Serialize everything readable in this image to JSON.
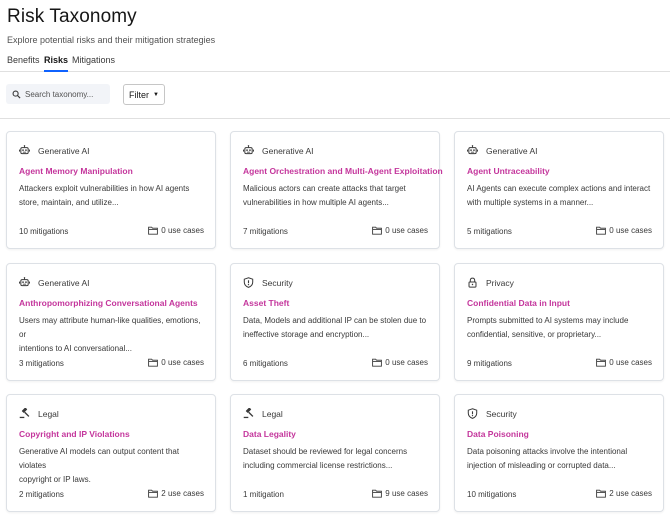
{
  "header": {
    "title": "Risk Taxonomy",
    "subtitle": "Explore potential risks and their mitigation strategies"
  },
  "tabs": [
    {
      "label": "Benefits",
      "active": false
    },
    {
      "label": "Risks",
      "active": true
    },
    {
      "label": "Mitigations",
      "active": false
    }
  ],
  "search": {
    "placeholder": "Search taxonomy...",
    "icon": "search-icon"
  },
  "filter": {
    "label": "Filter",
    "icon": "caret-down-icon"
  },
  "colors": {
    "accent": "#c4369c",
    "tab_underline": "#0f62fe"
  },
  "cards": [
    {
      "category": "Generative AI",
      "icon": "robot-icon",
      "title": "Agent Memory Manipulation",
      "desc1": "Attackers exploit vulnerabilities in how AI agents",
      "desc2": "store, maintain, and utilize...",
      "mitigations": "10 mitigations",
      "use_cases": "0 use cases"
    },
    {
      "category": "Generative AI",
      "icon": "robot-icon",
      "title": "Agent Orchestration and Multi-Agent Exploitation",
      "desc1": "Malicious actors can create attacks that target",
      "desc2": "vulnerabilities in how multiple AI agents...",
      "mitigations": "7 mitigations",
      "use_cases": "0 use cases"
    },
    {
      "category": "Generative AI",
      "icon": "robot-icon",
      "title": "Agent Untraceability",
      "desc1": "AI Agents can execute complex actions and interact",
      "desc2": "with multiple systems in a manner...",
      "mitigations": "5 mitigations",
      "use_cases": "0 use cases"
    },
    {
      "category": "Generative AI",
      "icon": "robot-icon",
      "title": "Anthropomorphizing Conversational Agents",
      "desc1": "Users may attribute human-like qualities, emotions, or",
      "desc2": "intentions to AI conversational...",
      "mitigations": "3 mitigations",
      "use_cases": "0 use cases"
    },
    {
      "category": "Security",
      "icon": "shield-icon",
      "title": "Asset Theft",
      "desc1": "Data, Models and additional IP can be stolen due to",
      "desc2": "ineffective storage and encryption...",
      "mitigations": "6 mitigations",
      "use_cases": "0 use cases"
    },
    {
      "category": "Privacy",
      "icon": "lock-icon",
      "title": "Confidential Data in Input",
      "desc1": "Prompts submitted to AI systems may include",
      "desc2": "confidential, sensitive, or proprietary...",
      "mitigations": "9 mitigations",
      "use_cases": "0 use cases"
    },
    {
      "category": "Legal",
      "icon": "gavel-icon",
      "title": "Copyright and IP Violations",
      "desc1": "Generative AI models can output content that violates",
      "desc2": "copyright or IP laws.",
      "mitigations": "2 mitigations",
      "use_cases": "2 use cases"
    },
    {
      "category": "Legal",
      "icon": "gavel-icon",
      "title": "Data Legality",
      "desc1": "Dataset should be reviewed for legal concerns",
      "desc2": "including commercial license restrictions...",
      "mitigations": "1 mitigation",
      "use_cases": "9 use cases"
    },
    {
      "category": "Security",
      "icon": "shield-icon",
      "title": "Data Poisoning",
      "desc1": "Data poisoning attacks involve the intentional",
      "desc2": "injection of misleading or corrupted data...",
      "mitigations": "10 mitigations",
      "use_cases": "2 use cases"
    }
  ]
}
